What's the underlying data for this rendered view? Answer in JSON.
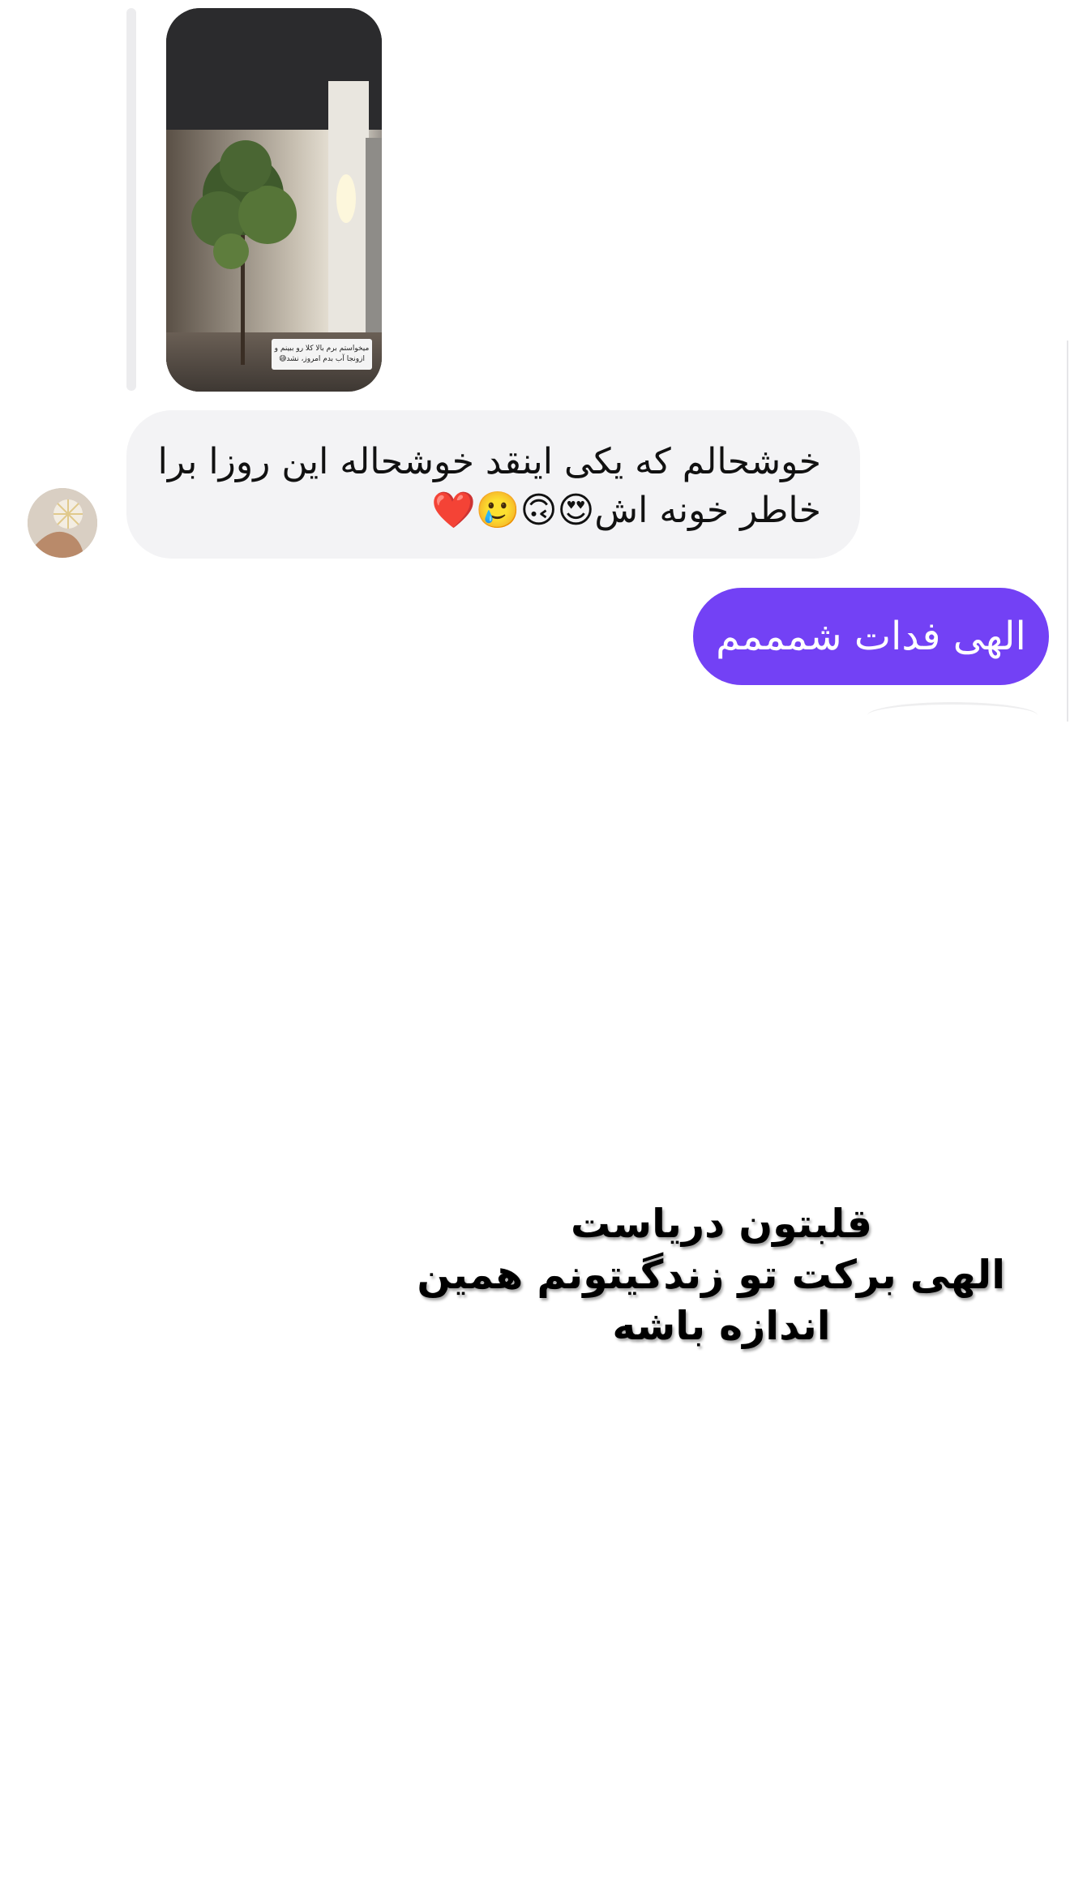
{
  "story_reply": {
    "caption_line1": "میخواستم برم بالا کلا رو ببینم و",
    "caption_line2": "ازونجا آب بدم امروز، نشد😅"
  },
  "messages": [
    {
      "direction": "incoming",
      "text": "خوشحالم که یکی اینقد خوشحاله این روزا برا خاطر خونه اش😍🙃🥲❤️"
    },
    {
      "direction": "outgoing",
      "text": "الهی فدات شمممم"
    }
  ],
  "sticker_text": {
    "line1": "قلبتون دریاست",
    "line2": "الهی برکت تو زندگیتونم همین",
    "line3": "اندازه باشه"
  },
  "colors": {
    "outgoing_bubble": "#7341f5",
    "incoming_bubble": "#f3f3f5"
  }
}
